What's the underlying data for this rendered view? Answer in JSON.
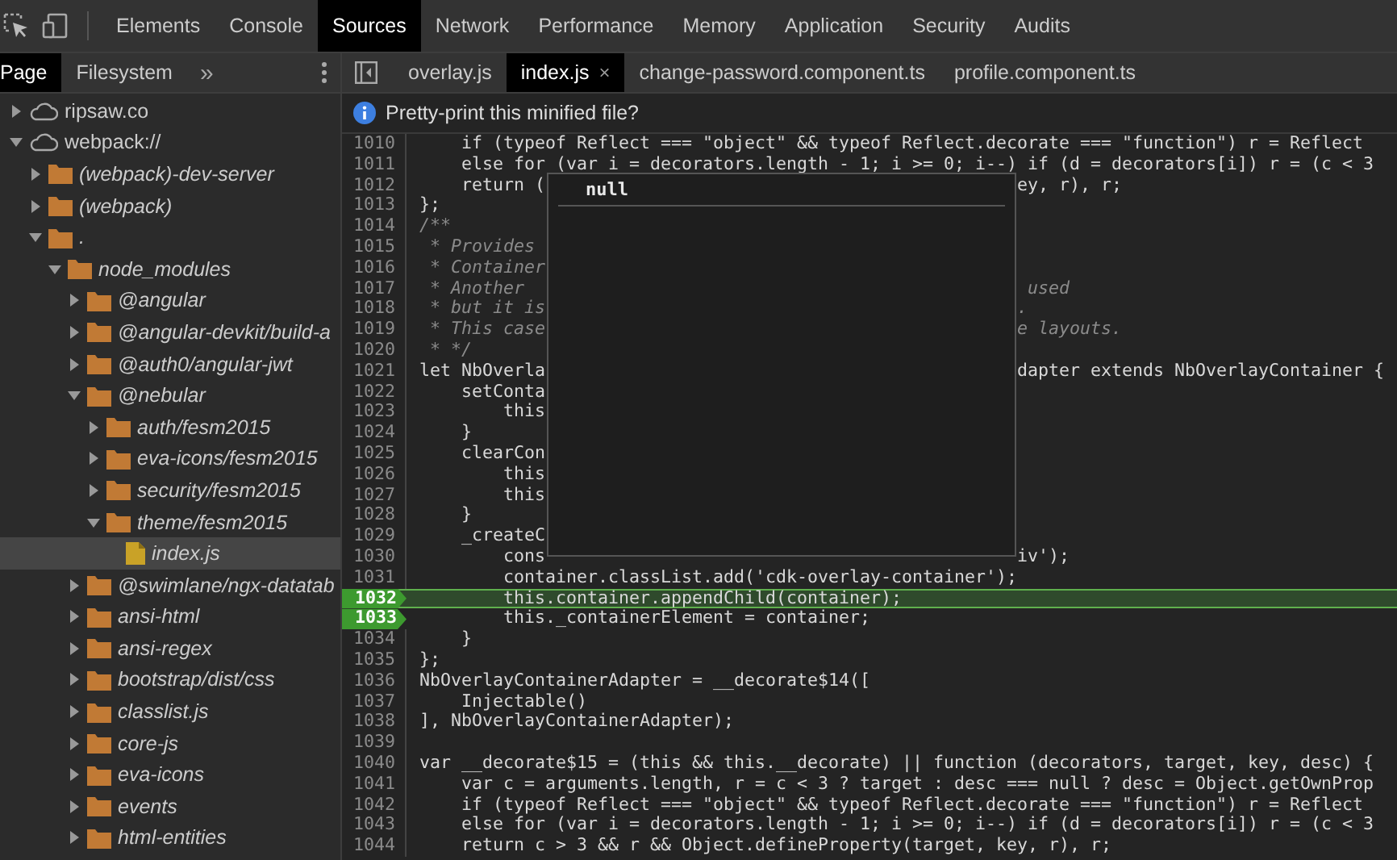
{
  "panels": [
    {
      "label": "Elements",
      "selected": false
    },
    {
      "label": "Console",
      "selected": false
    },
    {
      "label": "Sources",
      "selected": true
    },
    {
      "label": "Network",
      "selected": false
    },
    {
      "label": "Performance",
      "selected": false
    },
    {
      "label": "Memory",
      "selected": false
    },
    {
      "label": "Application",
      "selected": false
    },
    {
      "label": "Security",
      "selected": false
    },
    {
      "label": "Audits",
      "selected": false
    }
  ],
  "sidebar": {
    "tabs": [
      {
        "label": "Page",
        "selected": true
      },
      {
        "label": "Filesystem",
        "selected": false
      }
    ],
    "more": "»",
    "tree": [
      {
        "kind": "cloud",
        "label": "ripsaw.co",
        "expanded": false,
        "selected": false
      },
      {
        "kind": "cloud",
        "label": "webpack://",
        "expanded": true,
        "selected": false,
        "children": [
          {
            "kind": "folder",
            "label": "(webpack)-dev-server",
            "expanded": false,
            "selected": false
          },
          {
            "kind": "folder",
            "label": "(webpack)",
            "expanded": false,
            "selected": false
          },
          {
            "kind": "folder",
            "label": ".",
            "expanded": true,
            "selected": false,
            "children": [
              {
                "kind": "folder",
                "label": "node_modules",
                "expanded": true,
                "selected": false,
                "children": [
                  {
                    "kind": "folder",
                    "label": "@angular",
                    "expanded": false,
                    "selected": false
                  },
                  {
                    "kind": "folder",
                    "label": "@angular-devkit/build-a",
                    "expanded": false,
                    "selected": false
                  },
                  {
                    "kind": "folder",
                    "label": "@auth0/angular-jwt",
                    "expanded": false,
                    "selected": false
                  },
                  {
                    "kind": "folder",
                    "label": "@nebular",
                    "expanded": true,
                    "selected": false,
                    "children": [
                      {
                        "kind": "folder",
                        "label": "auth/fesm2015",
                        "expanded": false,
                        "selected": false
                      },
                      {
                        "kind": "folder",
                        "label": "eva-icons/fesm2015",
                        "expanded": false,
                        "selected": false
                      },
                      {
                        "kind": "folder",
                        "label": "security/fesm2015",
                        "expanded": false,
                        "selected": false
                      },
                      {
                        "kind": "folder",
                        "label": "theme/fesm2015",
                        "expanded": true,
                        "selected": false,
                        "children": [
                          {
                            "kind": "file",
                            "label": "index.js",
                            "selected": true
                          }
                        ]
                      }
                    ]
                  },
                  {
                    "kind": "folder",
                    "label": "@swimlane/ngx-datatab",
                    "expanded": false,
                    "selected": false
                  },
                  {
                    "kind": "folder",
                    "label": "ansi-html",
                    "expanded": false,
                    "selected": false
                  },
                  {
                    "kind": "folder",
                    "label": "ansi-regex",
                    "expanded": false,
                    "selected": false
                  },
                  {
                    "kind": "folder",
                    "label": "bootstrap/dist/css",
                    "expanded": false,
                    "selected": false
                  },
                  {
                    "kind": "folder",
                    "label": "classlist.js",
                    "expanded": false,
                    "selected": false
                  },
                  {
                    "kind": "folder",
                    "label": "core-js",
                    "expanded": false,
                    "selected": false
                  },
                  {
                    "kind": "folder",
                    "label": "eva-icons",
                    "expanded": false,
                    "selected": false
                  },
                  {
                    "kind": "folder",
                    "label": "events",
                    "expanded": false,
                    "selected": false
                  },
                  {
                    "kind": "folder",
                    "label": "html-entities",
                    "expanded": false,
                    "selected": false
                  }
                ]
              }
            ]
          }
        ]
      }
    ]
  },
  "editor": {
    "tabs": [
      {
        "label": "overlay.js",
        "selected": false
      },
      {
        "label": "index.js",
        "selected": true,
        "close": "×"
      },
      {
        "label": "change-password.component.ts",
        "selected": false
      },
      {
        "label": "profile.component.ts",
        "selected": false
      }
    ],
    "infobar": "Pretty-print this minified file?",
    "popover": {
      "value": "null"
    },
    "lines": [
      {
        "number": "1010",
        "kind": "code",
        "text": "    if (typeof Reflect === \"object\" && typeof Reflect.decorate === \"function\") r = Reflect",
        "breakpoint": false,
        "current": false
      },
      {
        "number": "1011",
        "kind": "code",
        "text": "    else for (var i = decorators.length - 1; i >= 0; i--) if (d = decorators[i]) r = (c < 3",
        "breakpoint": false,
        "current": false
      },
      {
        "number": "1012",
        "kind": "code",
        "text": "    return (",
        "right": "ey, r), r;",
        "breakpoint": false,
        "current": false
      },
      {
        "number": "1013",
        "kind": "code",
        "text": "};",
        "breakpoint": false,
        "current": false
      },
      {
        "number": "1014",
        "kind": "comment",
        "text": "/**",
        "breakpoint": false,
        "current": false
      },
      {
        "number": "1015",
        "kind": "comment",
        "text": " * Provides",
        "breakpoint": false,
        "current": false
      },
      {
        "number": "1016",
        "kind": "comment",
        "text": " * Container",
        "breakpoint": false,
        "current": false
      },
      {
        "number": "1017",
        "kind": "comment",
        "text": " * Another",
        "right": " used",
        "breakpoint": false,
        "current": false
      },
      {
        "number": "1018",
        "kind": "comment",
        "text": " * but it is",
        "right": ".",
        "breakpoint": false,
        "current": false
      },
      {
        "number": "1019",
        "kind": "comment",
        "text": " * This case",
        "right": "e layouts.",
        "breakpoint": false,
        "current": false
      },
      {
        "number": "1020",
        "kind": "comment",
        "text": " * */",
        "breakpoint": false,
        "current": false
      },
      {
        "number": "1021",
        "kind": "code",
        "text": "let NbOverla",
        "right": "dapter extends NbOverlayContainer {",
        "breakpoint": false,
        "current": false
      },
      {
        "number": "1022",
        "kind": "code",
        "text": "    setConta",
        "breakpoint": false,
        "current": false
      },
      {
        "number": "1023",
        "kind": "code",
        "text": "        this",
        "breakpoint": false,
        "current": false
      },
      {
        "number": "1024",
        "kind": "code",
        "text": "    }",
        "breakpoint": false,
        "current": false
      },
      {
        "number": "1025",
        "kind": "code",
        "text": "    clearCon",
        "breakpoint": false,
        "current": false
      },
      {
        "number": "1026",
        "kind": "code",
        "text": "        this",
        "breakpoint": false,
        "current": false
      },
      {
        "number": "1027",
        "kind": "code",
        "text": "        this",
        "breakpoint": false,
        "current": false
      },
      {
        "number": "1028",
        "kind": "code",
        "text": "    }",
        "breakpoint": false,
        "current": false
      },
      {
        "number": "1029",
        "kind": "code",
        "text": "    _createC",
        "breakpoint": false,
        "current": false
      },
      {
        "number": "1030",
        "kind": "code",
        "text": "        cons",
        "right": "iv');",
        "breakpoint": false,
        "current": false
      },
      {
        "number": "1031",
        "kind": "code",
        "text": "        container.classList.add('cdk-overlay-container');",
        "breakpoint": false,
        "current": false
      },
      {
        "number": "1032",
        "kind": "code",
        "text": "        this.container.appendChild(container);",
        "breakpoint": true,
        "current": true
      },
      {
        "number": "1033",
        "kind": "code",
        "text": "        this._containerElement = container;",
        "breakpoint": true,
        "current": false
      },
      {
        "number": "1034",
        "kind": "code",
        "text": "    }",
        "breakpoint": false,
        "current": false
      },
      {
        "number": "1035",
        "kind": "code",
        "text": "};",
        "breakpoint": false,
        "current": false
      },
      {
        "number": "1036",
        "kind": "code",
        "text": "NbOverlayContainerAdapter = __decorate$14([",
        "breakpoint": false,
        "current": false
      },
      {
        "number": "1037",
        "kind": "code",
        "text": "    Injectable()",
        "breakpoint": false,
        "current": false
      },
      {
        "number": "1038",
        "kind": "code",
        "text": "], NbOverlayContainerAdapter);",
        "breakpoint": false,
        "current": false
      },
      {
        "number": "1039",
        "breakpoint": false,
        "current": false
      },
      {
        "number": "1040",
        "kind": "code",
        "text": "var __decorate$15 = (this && this.__decorate) || function (decorators, target, key, desc) {",
        "breakpoint": false,
        "current": false
      },
      {
        "number": "1041",
        "kind": "code",
        "text": "    var c = arguments.length, r = c < 3 ? target : desc === null ? desc = Object.getOwnProp",
        "breakpoint": false,
        "current": false
      },
      {
        "number": "1042",
        "kind": "code",
        "text": "    if (typeof Reflect === \"object\" && typeof Reflect.decorate === \"function\") r = Reflect",
        "breakpoint": false,
        "current": false
      },
      {
        "number": "1043",
        "kind": "code",
        "text": "    else for (var i = decorators.length - 1; i >= 0; i--) if (d = decorators[i]) r = (c < 3",
        "breakpoint": false,
        "current": false
      },
      {
        "number": "1044",
        "kind": "code",
        "text": "    return c > 3 && r && Object.defineProperty(target, key, r), r;",
        "breakpoint": false,
        "current": false
      }
    ]
  }
}
